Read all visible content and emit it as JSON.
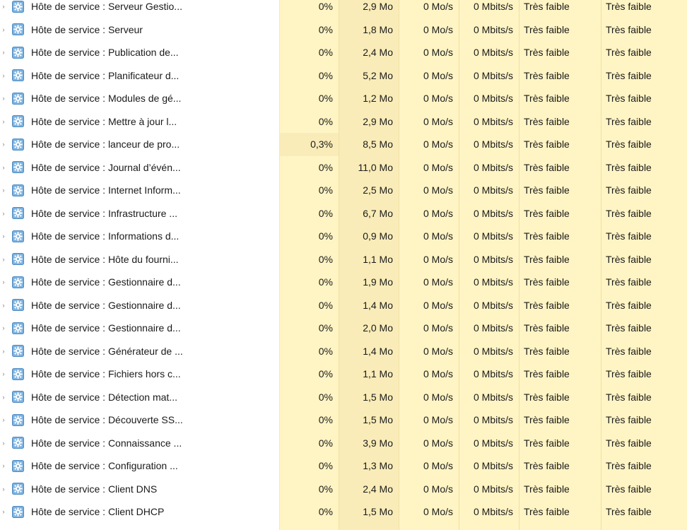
{
  "icon": "gear-service-icon",
  "rows": [
    {
      "name": "Hôte de service : Serveur Gestio...",
      "cpu": "0%",
      "memory": "2,9 Mo",
      "disk": "0 Mo/s",
      "network": "0 Mbits/s",
      "power": "Très faible",
      "power_trend": "Très faible"
    },
    {
      "name": "Hôte de service : Serveur",
      "cpu": "0%",
      "memory": "1,8 Mo",
      "disk": "0 Mo/s",
      "network": "0 Mbits/s",
      "power": "Très faible",
      "power_trend": "Très faible"
    },
    {
      "name": "Hôte de service : Publication de...",
      "cpu": "0%",
      "memory": "2,4 Mo",
      "disk": "0 Mo/s",
      "network": "0 Mbits/s",
      "power": "Très faible",
      "power_trend": "Très faible"
    },
    {
      "name": "Hôte de service : Planificateur d...",
      "cpu": "0%",
      "memory": "5,2 Mo",
      "disk": "0 Mo/s",
      "network": "0 Mbits/s",
      "power": "Très faible",
      "power_trend": "Très faible"
    },
    {
      "name": "Hôte de service : Modules de gé...",
      "cpu": "0%",
      "memory": "1,2 Mo",
      "disk": "0 Mo/s",
      "network": "0 Mbits/s",
      "power": "Très faible",
      "power_trend": "Très faible"
    },
    {
      "name": "Hôte de service : Mettre à jour l...",
      "cpu": "0%",
      "memory": "2,9 Mo",
      "disk": "0 Mo/s",
      "network": "0 Mbits/s",
      "power": "Très faible",
      "power_trend": "Très faible"
    },
    {
      "name": "Hôte de service : lanceur de pro...",
      "cpu": "0,3%",
      "memory": "8,5 Mo",
      "disk": "0 Mo/s",
      "network": "0 Mbits/s",
      "power": "Très faible",
      "power_trend": "Très faible",
      "cpu_hot": true
    },
    {
      "name": "Hôte de service : Journal d’évén...",
      "cpu": "0%",
      "memory": "11,0 Mo",
      "disk": "0 Mo/s",
      "network": "0 Mbits/s",
      "power": "Très faible",
      "power_trend": "Très faible"
    },
    {
      "name": "Hôte de service : Internet Inform...",
      "cpu": "0%",
      "memory": "2,5 Mo",
      "disk": "0 Mo/s",
      "network": "0 Mbits/s",
      "power": "Très faible",
      "power_trend": "Très faible"
    },
    {
      "name": "Hôte de service : Infrastructure ...",
      "cpu": "0%",
      "memory": "6,7 Mo",
      "disk": "0 Mo/s",
      "network": "0 Mbits/s",
      "power": "Très faible",
      "power_trend": "Très faible"
    },
    {
      "name": "Hôte de service : Informations d...",
      "cpu": "0%",
      "memory": "0,9 Mo",
      "disk": "0 Mo/s",
      "network": "0 Mbits/s",
      "power": "Très faible",
      "power_trend": "Très faible"
    },
    {
      "name": "Hôte de service : Hôte du fourni...",
      "cpu": "0%",
      "memory": "1,1 Mo",
      "disk": "0 Mo/s",
      "network": "0 Mbits/s",
      "power": "Très faible",
      "power_trend": "Très faible"
    },
    {
      "name": "Hôte de service : Gestionnaire d...",
      "cpu": "0%",
      "memory": "1,9 Mo",
      "disk": "0 Mo/s",
      "network": "0 Mbits/s",
      "power": "Très faible",
      "power_trend": "Très faible"
    },
    {
      "name": "Hôte de service : Gestionnaire d...",
      "cpu": "0%",
      "memory": "1,4 Mo",
      "disk": "0 Mo/s",
      "network": "0 Mbits/s",
      "power": "Très faible",
      "power_trend": "Très faible"
    },
    {
      "name": "Hôte de service : Gestionnaire d...",
      "cpu": "0%",
      "memory": "2,0 Mo",
      "disk": "0 Mo/s",
      "network": "0 Mbits/s",
      "power": "Très faible",
      "power_trend": "Très faible"
    },
    {
      "name": "Hôte de service : Générateur de ...",
      "cpu": "0%",
      "memory": "1,4 Mo",
      "disk": "0 Mo/s",
      "network": "0 Mbits/s",
      "power": "Très faible",
      "power_trend": "Très faible"
    },
    {
      "name": "Hôte de service : Fichiers hors c...",
      "cpu": "0%",
      "memory": "1,1 Mo",
      "disk": "0 Mo/s",
      "network": "0 Mbits/s",
      "power": "Très faible",
      "power_trend": "Très faible"
    },
    {
      "name": "Hôte de service : Détection mat...",
      "cpu": "0%",
      "memory": "1,5 Mo",
      "disk": "0 Mo/s",
      "network": "0 Mbits/s",
      "power": "Très faible",
      "power_trend": "Très faible"
    },
    {
      "name": "Hôte de service : Découverte SS...",
      "cpu": "0%",
      "memory": "1,5 Mo",
      "disk": "0 Mo/s",
      "network": "0 Mbits/s",
      "power": "Très faible",
      "power_trend": "Très faible"
    },
    {
      "name": "Hôte de service : Connaissance ...",
      "cpu": "0%",
      "memory": "3,9 Mo",
      "disk": "0 Mo/s",
      "network": "0 Mbits/s",
      "power": "Très faible",
      "power_trend": "Très faible"
    },
    {
      "name": "Hôte de service : Configuration ...",
      "cpu": "0%",
      "memory": "1,3 Mo",
      "disk": "0 Mo/s",
      "network": "0 Mbits/s",
      "power": "Très faible",
      "power_trend": "Très faible"
    },
    {
      "name": "Hôte de service : Client DNS",
      "cpu": "0%",
      "memory": "2,4 Mo",
      "disk": "0 Mo/s",
      "network": "0 Mbits/s",
      "power": "Très faible",
      "power_trend": "Très faible"
    },
    {
      "name": "Hôte de service : Client DHCP",
      "cpu": "0%",
      "memory": "1,5 Mo",
      "disk": "0 Mo/s",
      "network": "0 Mbits/s",
      "power": "Très faible",
      "power_trend": "Très faible"
    }
  ]
}
